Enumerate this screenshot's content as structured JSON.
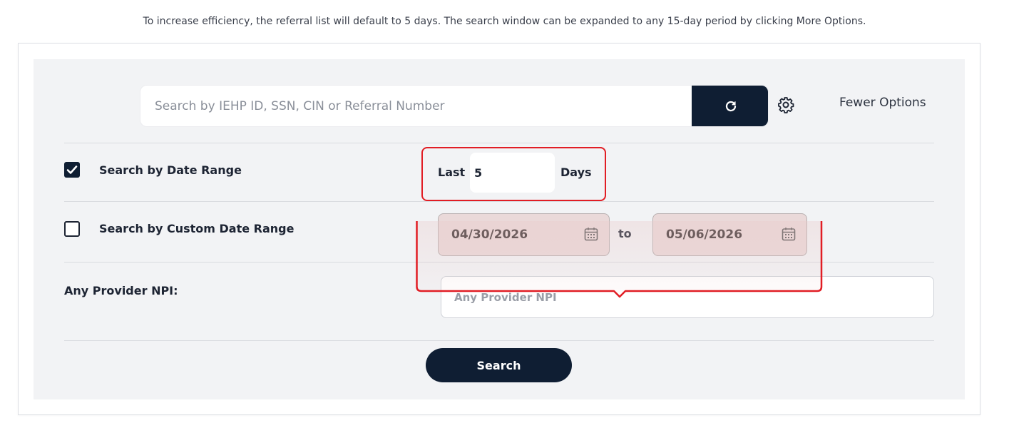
{
  "notice": "To increase efficiency, the referral list will default to 5 days. The search window can be expanded to any 15-day period by clicking More Options.",
  "search": {
    "placeholder": "Search by IEHP ID, SSN, CIN or Referral Number",
    "value": "",
    "refresh_icon": "refresh-icon",
    "settings_icon": "gear-icon",
    "options_link": "Fewer Options"
  },
  "date_range": {
    "checked": true,
    "label": "Search by Date Range",
    "last_label": "Last",
    "days_value": "5",
    "days_label": "Days"
  },
  "custom_range": {
    "checked": false,
    "label": "Search by Custom Date Range",
    "from": "04/30/2026",
    "to_label": "to",
    "to": "05/06/2026",
    "calendar_icon": "calendar-icon"
  },
  "provider": {
    "label": "Any Provider NPI:",
    "placeholder": "Any Provider NPI",
    "value": ""
  },
  "search_button": "Search",
  "colors": {
    "navy": "#0f1e33",
    "panel": "#f2f3f5",
    "annotation_red": "#e11d24"
  }
}
